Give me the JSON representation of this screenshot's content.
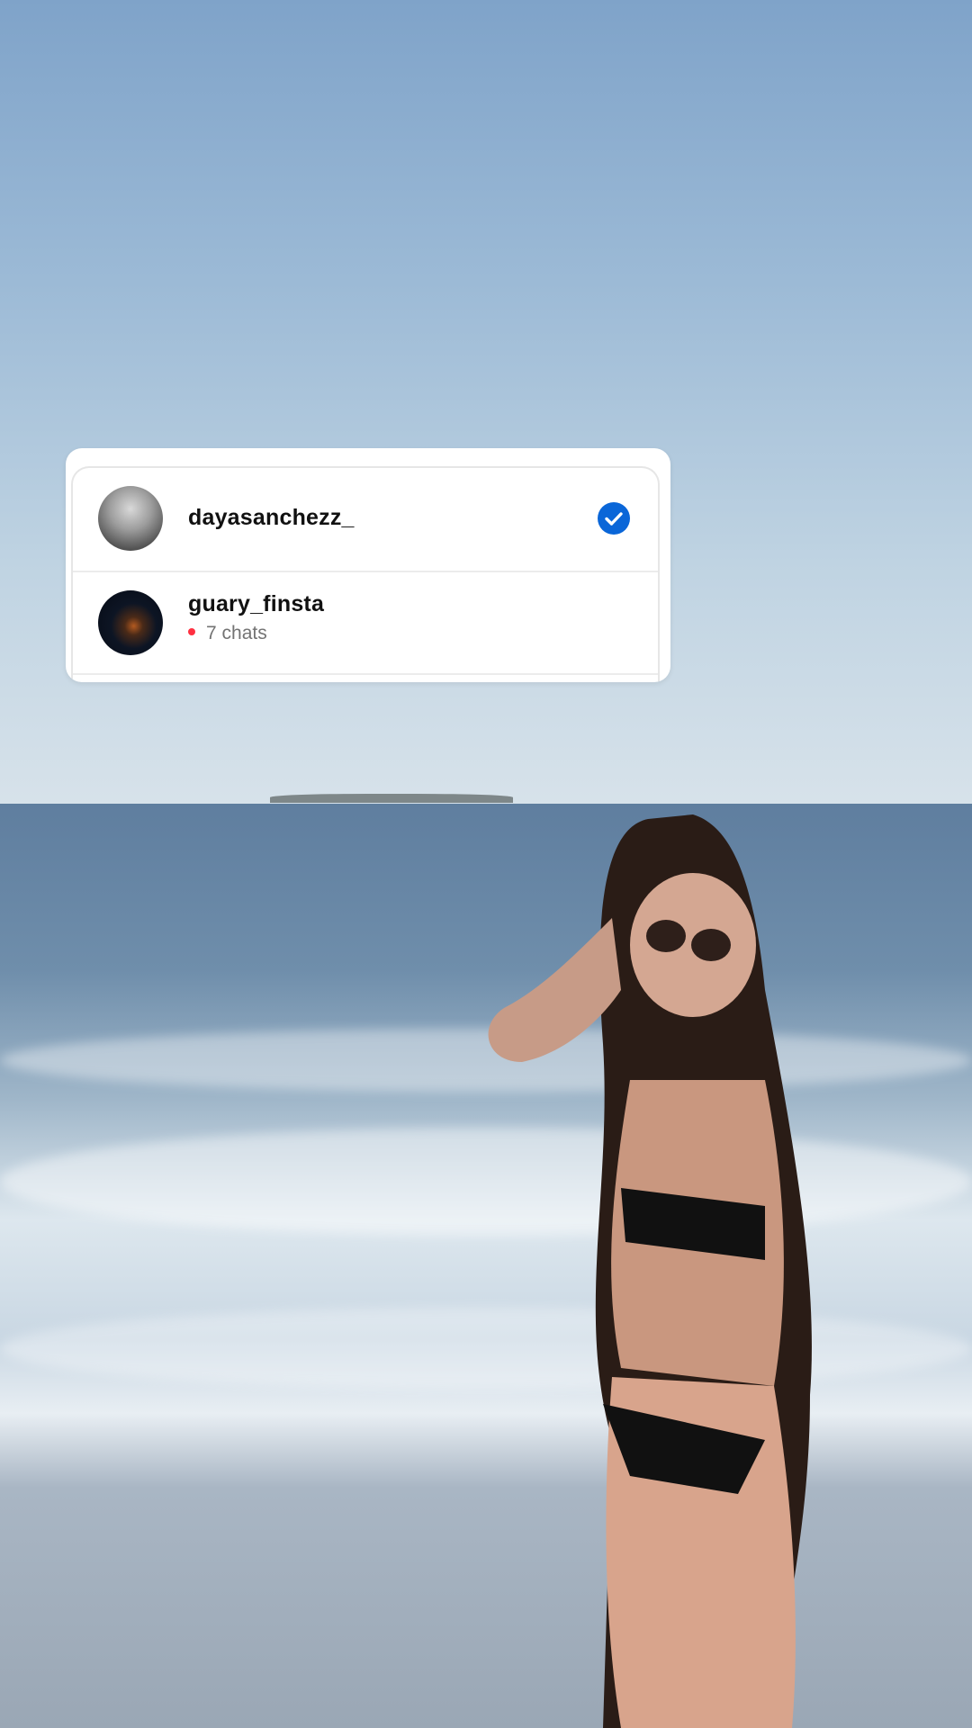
{
  "accounts": [
    {
      "username": "dayasanchezz_",
      "selected": true,
      "avatar_icon": "profile-photo-icon"
    },
    {
      "username": "guary_finsta",
      "notification_dot_color": "#ff3040",
      "chats_label": "7 chats",
      "avatar_icon": "profile-photo-icon"
    }
  ],
  "colors": {
    "check_blue": "#0a66d8",
    "card_bg": "#ffffff"
  }
}
